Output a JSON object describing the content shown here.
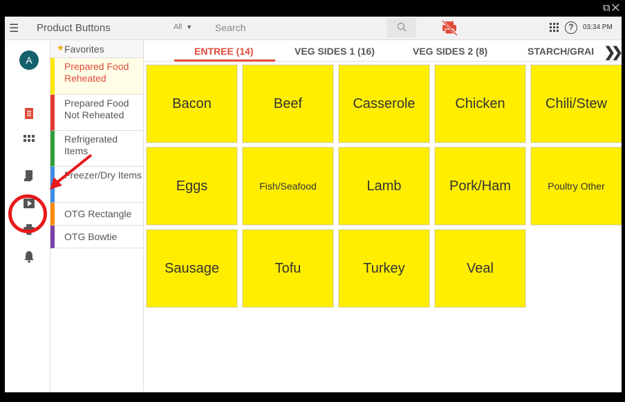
{
  "window": {
    "controls": "⧉✕"
  },
  "topbar": {
    "title": "Product Buttons",
    "filter_value": "All",
    "search_placeholder": "Search",
    "time": "03:34 PM",
    "help": "?"
  },
  "user": {
    "initial": "A"
  },
  "rail_icons": [
    "receipt-icon",
    "grid-icon",
    "document-icon",
    "play-folder-icon",
    "printer-icon",
    "bell-icon"
  ],
  "categories": {
    "favorites": "Favorites",
    "items": [
      {
        "label": "Prepared Food Reheated",
        "color": "#ffe600",
        "active": true
      },
      {
        "label": "Prepared Food Not Reheated",
        "color": "#e53935"
      },
      {
        "label": "Refrigerated Items",
        "color": "#2e9e3a"
      },
      {
        "label": "Freezer/Dry Items",
        "color": "#3c8ee6"
      },
      {
        "label": "OTG Rectangle",
        "color": "#ff8a00"
      },
      {
        "label": "OTG Bowtie",
        "color": "#7b3fa8"
      }
    ]
  },
  "tabs": [
    {
      "label": "ENTREE (14)",
      "active": true
    },
    {
      "label": "VEG SIDES 1 (16)"
    },
    {
      "label": "VEG SIDES 2 (8)"
    },
    {
      "label": "STARCH/GRAI"
    }
  ],
  "products": [
    "Bacon",
    "Beef",
    "Casserole",
    "Chicken",
    "Chili/Stew",
    "Eggs",
    "Fish/Seafood",
    "Lamb",
    "Pork/Ham",
    "Poultry Other",
    "Sausage",
    "Tofu",
    "Turkey",
    "Veal"
  ],
  "colors": {
    "accent": "#e04b3a",
    "tile": "#ffee00",
    "annotation": "#e8191a"
  }
}
